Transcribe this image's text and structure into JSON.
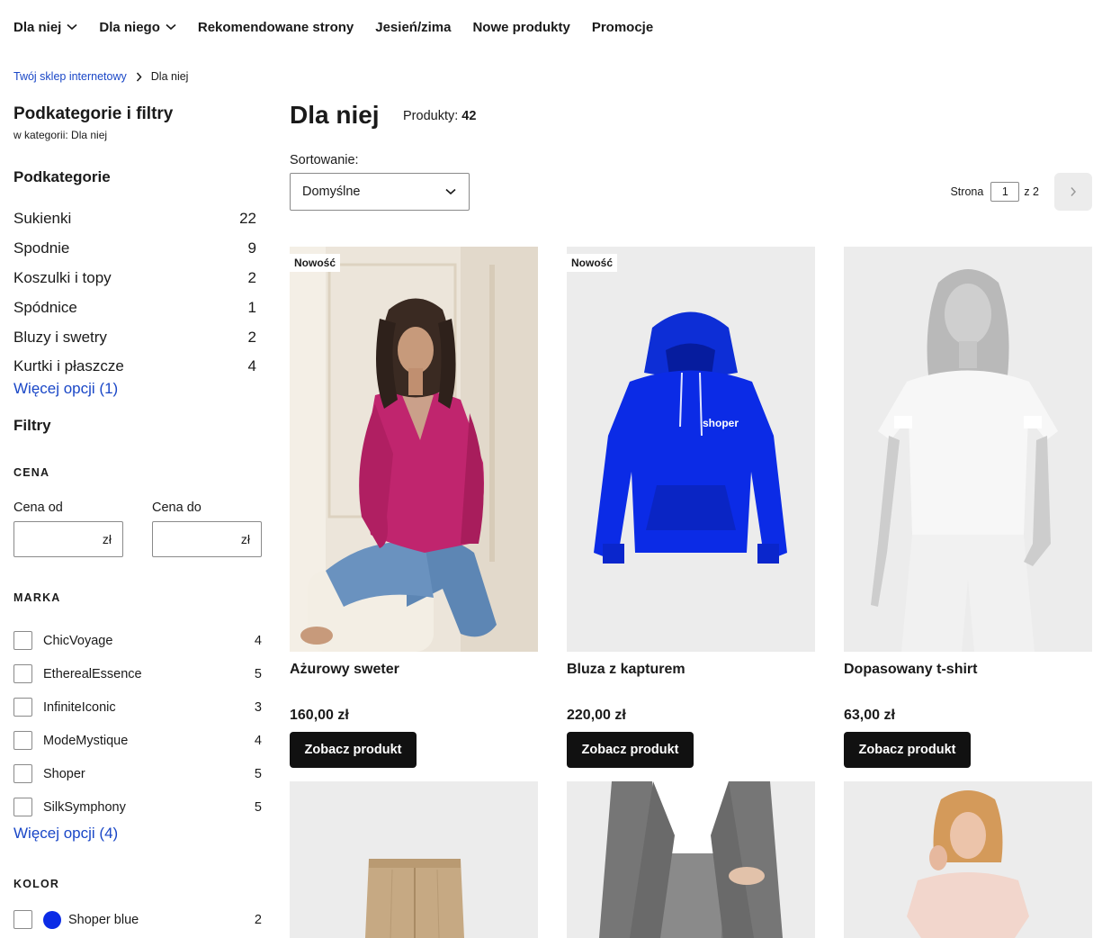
{
  "nav": {
    "items": [
      {
        "label": "Dla niej",
        "has_dropdown": true
      },
      {
        "label": "Dla niego",
        "has_dropdown": true
      },
      {
        "label": "Rekomendowane strony",
        "has_dropdown": false
      },
      {
        "label": "Jesień/zima",
        "has_dropdown": false
      },
      {
        "label": "Nowe produkty",
        "has_dropdown": false
      },
      {
        "label": "Promocje",
        "has_dropdown": false
      }
    ]
  },
  "breadcrumb": {
    "home": "Twój sklep internetowy",
    "current": "Dla niej"
  },
  "sidebar": {
    "title": "Podkategorie i filtry",
    "subtitle": "w kategorii: Dla niej",
    "subcategories_title": "Podkategorie",
    "subcategories": [
      {
        "label": "Sukienki",
        "count": "22"
      },
      {
        "label": "Spodnie",
        "count": "9"
      },
      {
        "label": "Koszulki i topy",
        "count": "2"
      },
      {
        "label": "Spódnice",
        "count": "1"
      },
      {
        "label": "Bluzy i swetry",
        "count": "2"
      },
      {
        "label": "Kurtki i płaszcze",
        "count": "4"
      }
    ],
    "subcategories_more": "Więcej opcji (1)",
    "filters_title": "Filtry",
    "price": {
      "label": "CENA",
      "from_label": "Cena od",
      "to_label": "Cena do",
      "from_value": "",
      "to_value": "",
      "currency": "zł"
    },
    "brand": {
      "label": "MARKA",
      "items": [
        {
          "label": "ChicVoyage",
          "count": "4"
        },
        {
          "label": "EtherealEssence",
          "count": "5"
        },
        {
          "label": "InfiniteIconic",
          "count": "3"
        },
        {
          "label": "ModeMystique",
          "count": "4"
        },
        {
          "label": "Shoper",
          "count": "5"
        },
        {
          "label": "SilkSymphony",
          "count": "5"
        }
      ],
      "more": "Więcej opcji (4)"
    },
    "color": {
      "label": "KOLOR",
      "items": [
        {
          "label": "Shoper blue",
          "count": "2",
          "swatch": "#0b2be6"
        }
      ]
    }
  },
  "main": {
    "title": "Dla niej",
    "products_label": "Produkty:",
    "products_count": "42",
    "sort_label": "Sortowanie:",
    "sort_value": "Domyślne",
    "pager": {
      "page_label": "Strona",
      "current_page": "1",
      "of_label": "z 2"
    },
    "products": [
      {
        "name": "Ażurowy sweter",
        "price": "160,00 zł",
        "badge": "Nowość",
        "button": "Zobacz produkt",
        "image": "woman-pink-sweater-photo"
      },
      {
        "name": "Bluza z kapturem",
        "price": "220,00 zł",
        "badge": "Nowość",
        "button": "Zobacz produkt",
        "image": "blue-hoodie-photo",
        "image_text": "shoper"
      },
      {
        "name": "Dopasowany t-shirt",
        "price": "63,00 zł",
        "badge": "",
        "button": "Zobacz produkt",
        "image": "woman-white-tshirt-photo"
      }
    ],
    "next_row_images": [
      "beige-trousers-photo",
      "grey-suit-photo",
      "woman-pink-top-photo"
    ]
  },
  "colors": {
    "link": "#1a47c7",
    "button_bg": "#111111",
    "image_bg": "#ececec",
    "sweater": "#c0256e",
    "hoodie": "#0b2be6"
  }
}
